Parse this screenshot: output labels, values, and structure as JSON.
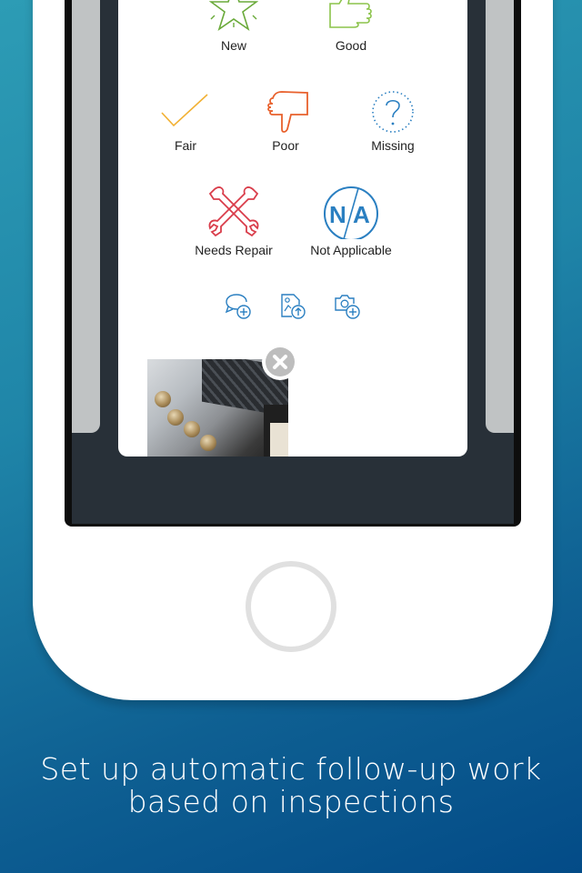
{
  "ratings": [
    {
      "label": "New",
      "icon": "star-icon",
      "color": "#6aaa3a"
    },
    {
      "label": "Good",
      "icon": "thumbs-up-icon",
      "color": "#8bc34a"
    },
    {
      "label": "Fair",
      "icon": "checkmark-icon",
      "color": "#f2b134"
    },
    {
      "label": "Poor",
      "icon": "thumbs-down-icon",
      "color": "#e8602c"
    },
    {
      "label": "Missing",
      "icon": "question-circle-icon",
      "color": "#2a7fc1"
    },
    {
      "label": "Needs Repair",
      "icon": "crossed-wrenches-icon",
      "color": "#d93c4a"
    },
    {
      "label": "Not Applicable",
      "icon": "not-applicable-icon",
      "color": "#2a7fc1"
    }
  ],
  "actions": [
    {
      "name": "add-comment",
      "icon": "comment-add-icon"
    },
    {
      "name": "upload-image",
      "icon": "image-upload-icon"
    },
    {
      "name": "add-photo",
      "icon": "camera-add-icon"
    }
  ],
  "attachment": {
    "icon": "close-icon",
    "alt": "Stove photo"
  },
  "caption": {
    "line1": "Set up automatic follow-up work",
    "line2": "based on inspections"
  },
  "colors": {
    "accent": "#2a7fc1",
    "screen_bg": "#283038",
    "background_start": "#2d9cb5",
    "background_end": "#034b87"
  }
}
